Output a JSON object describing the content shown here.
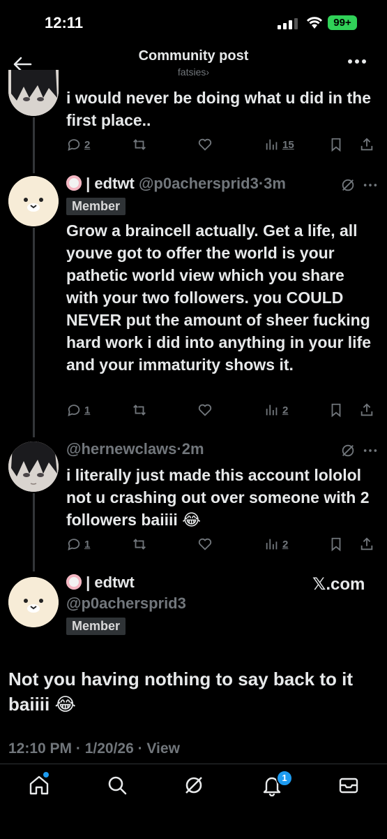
{
  "status_bar": {
    "time": "12:11",
    "battery": "99+"
  },
  "header": {
    "title": "Community post",
    "community": "fatsies",
    "community_chevron": "›"
  },
  "posts": [
    {
      "text": "i would never be doing what u did in the first place..",
      "replies": "2",
      "reposts": "",
      "likes": "",
      "views": "15"
    },
    {
      "name": "| edtwt",
      "handle": "@p0achersprid3",
      "time": "·3m",
      "badge": "Member",
      "text": "Grow a braincell actually. Get a life, all youve got to offer the world is your pathetic world view which you share with your two followers. you COULD NEVER put the amount of sheer fucking hard work i did into anything in your life and your immaturity shows it.",
      "replies": "1",
      "views": "2"
    },
    {
      "handle": "@hernewclaws",
      "time": "·2m",
      "text": "i literally just made this account lololol not u crashing out over someone with 2 followers baiiii 😂",
      "replies": "1",
      "views": "2"
    }
  ],
  "focused_post": {
    "name": "| edtwt",
    "handle": "@p0achersprid3",
    "badge": "Member",
    "source": "𝕏.com",
    "text": "Not you having nothing to say back to it baiiii 😂",
    "meta": "12:10 PM · 1/20/26 · View"
  },
  "nav": {
    "notifications_count": "1"
  }
}
